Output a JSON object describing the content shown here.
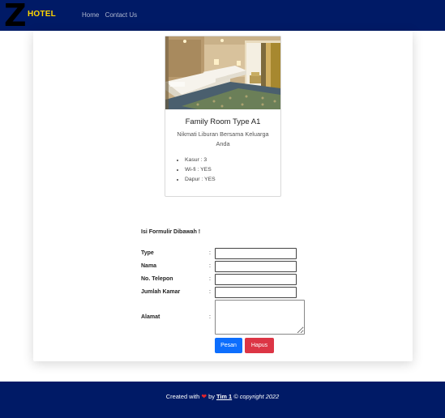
{
  "navbar": {
    "brand_letter": "Z",
    "brand_text": "HOTEL",
    "links": [
      "Home",
      "Contact Us"
    ],
    "colors": {
      "background": "#001a66",
      "brand": "#ffd500",
      "link": "#aeb7cf"
    }
  },
  "room": {
    "image_icon": "hotel-room-photo",
    "title": "Family Room Type A1",
    "description": "Nikmati Liburan Bersama Keluarga Anda",
    "features": [
      "Kasur : 3",
      "Wi-fi : YES",
      "Dapur : YES"
    ]
  },
  "form": {
    "title": "Isi Formulir Dibawah !",
    "colon": ":",
    "fields": [
      {
        "label": "Type",
        "value": ""
      },
      {
        "label": "Nama",
        "value": ""
      },
      {
        "label": "No. Telepon",
        "value": ""
      },
      {
        "label": "Jumlah Kamar",
        "value": ""
      },
      {
        "label": "Alamat",
        "value": ""
      }
    ],
    "submit_label": "Pesan",
    "reset_label": "Hapus",
    "colors": {
      "submit": "#0d6efd",
      "reset": "#dc3545"
    }
  },
  "footer": {
    "prefix": "Created with",
    "heart_icon": "heart-icon",
    "heart": "❤",
    "by": "by",
    "team": "Tim 1",
    "copyright": "© copyright 2022",
    "colors": {
      "background": "#001a66",
      "heart": "#e0242c"
    }
  }
}
